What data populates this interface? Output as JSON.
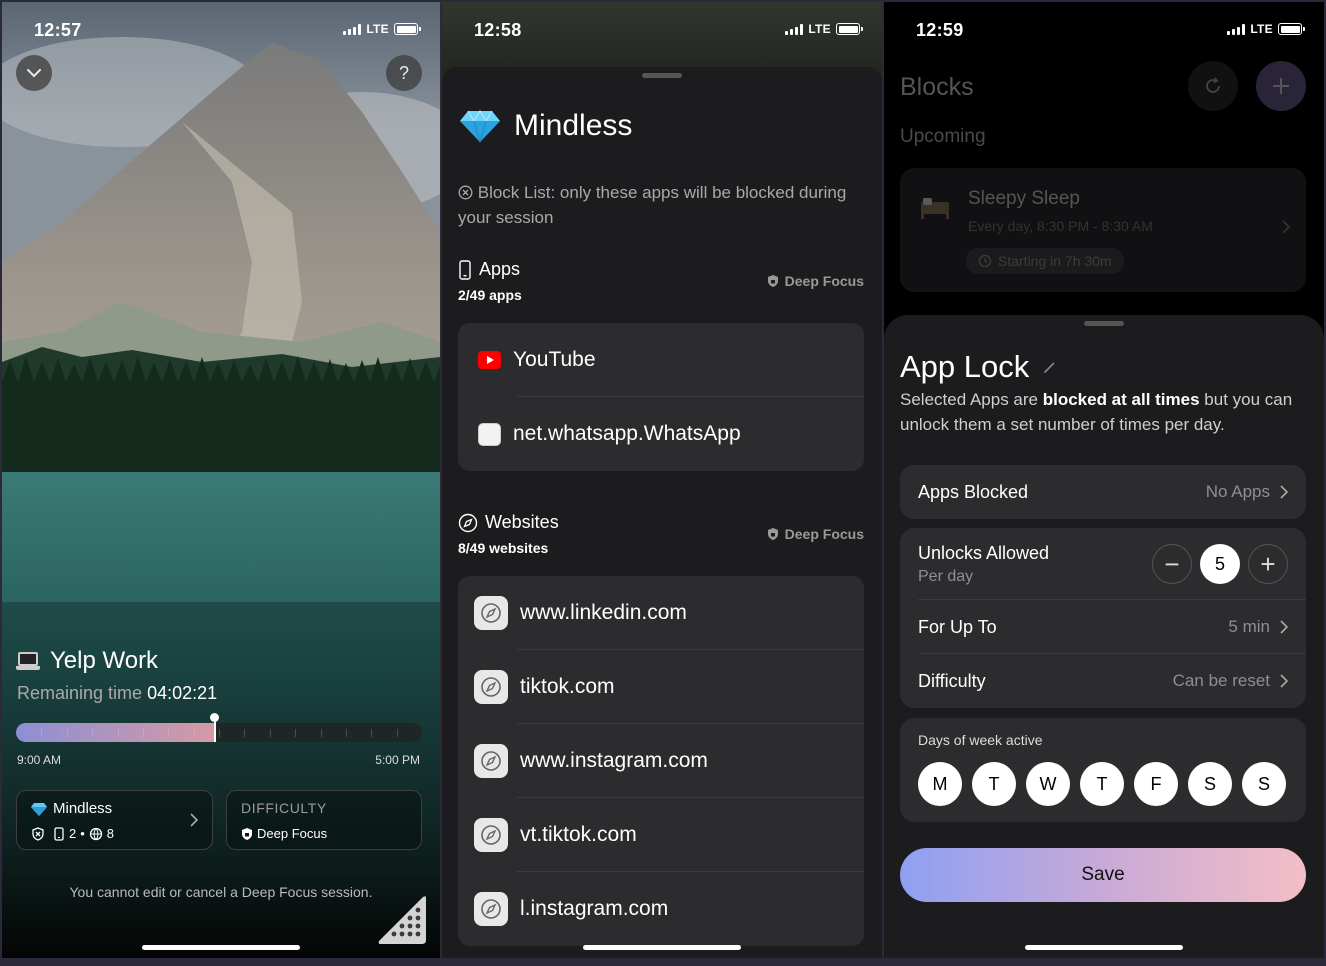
{
  "status": {
    "screen1_time": "12:57",
    "screen2_time": "12:58",
    "screen3_time": "12:59",
    "network": "LTE"
  },
  "screen1": {
    "help_label": "?",
    "session_title": "Yelp Work",
    "remaining_label": "Remaining time",
    "remaining_value": "04:02:21",
    "progress_fraction": 0.49,
    "start_time": "9:00 AM",
    "end_time": "5:00 PM",
    "block_card": {
      "name": "Mindless",
      "apps_count": "2",
      "dot": "•",
      "websites_count": "8"
    },
    "difficulty_card": {
      "label": "DIFFICULTY",
      "value": "Deep Focus"
    },
    "note": "You cannot edit or cancel a Deep Focus session."
  },
  "screen2": {
    "title": "Mindless",
    "description": "Block List: only these apps will be blocked during your session",
    "apps_section": {
      "label": "Apps",
      "count": "2/49 apps",
      "tag": "Deep Focus",
      "items": [
        "YouTube",
        "net.whatsapp.WhatsApp"
      ]
    },
    "websites_section": {
      "label": "Websites",
      "count": "8/49 websites",
      "tag": "Deep Focus",
      "items": [
        "www.linkedin.com",
        "tiktok.com",
        "www.instagram.com",
        "vt.tiktok.com",
        "l.instagram.com"
      ]
    }
  },
  "screen3": {
    "background": {
      "title": "Blocks",
      "section": "Upcoming",
      "card_name": "Sleepy Sleep",
      "card_schedule": "Every day, 8:30 PM - 8:30 AM",
      "card_status": "Starting in 7h 30m"
    },
    "title": "App Lock",
    "desc_pre": "Selected Apps are ",
    "desc_bold": "blocked at all times",
    "desc_post": " but you can unlock them a set number of times per day.",
    "apps_blocked_label": "Apps Blocked",
    "apps_blocked_value": "No Apps",
    "unlocks_label": "Unlocks Allowed",
    "unlocks_sub": "Per day",
    "unlocks_value": "5",
    "minus": "−",
    "plus": "+",
    "for_up_to_label": "For Up To",
    "for_up_to_value": "5 min",
    "difficulty_label": "Difficulty",
    "difficulty_value": "Can be reset",
    "days_title": "Days of week active",
    "days": [
      "M",
      "T",
      "W",
      "T",
      "F",
      "S",
      "S"
    ],
    "save_label": "Save"
  },
  "colors": {
    "progress_start": "#8c8fd4",
    "progress_end": "#d69aa4",
    "save_gradient": [
      "#8ea0f2",
      "#c8a9d8",
      "#f4bec6"
    ],
    "sheet_bg": "#1c1c1e",
    "row_bg": "#2c2c2e"
  }
}
